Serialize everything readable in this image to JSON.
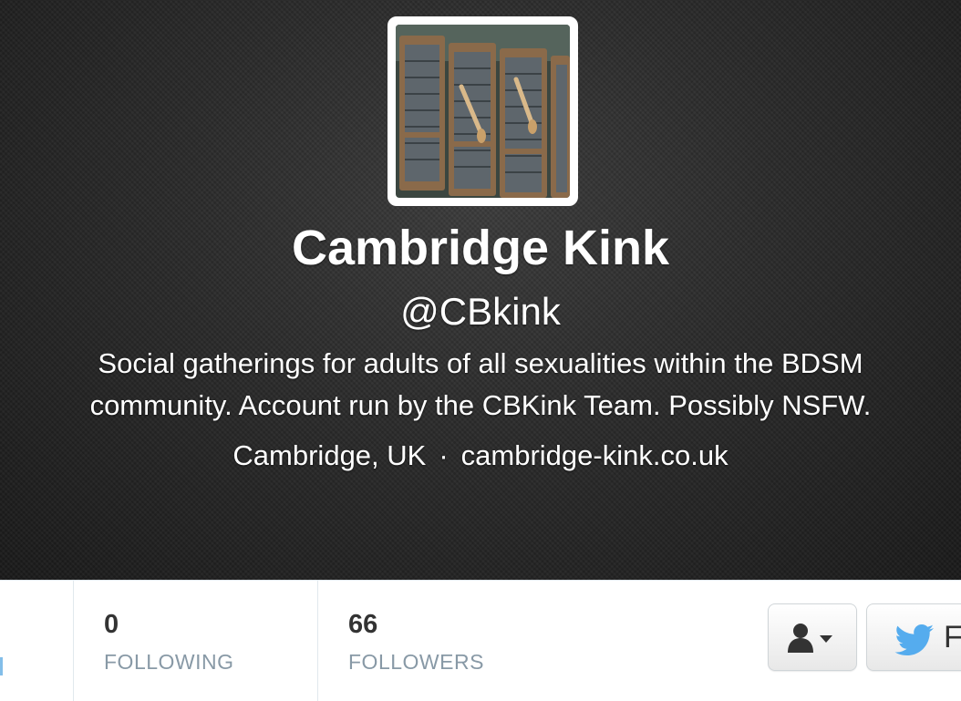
{
  "profile": {
    "name": "Cambridge Kink",
    "handle": "@CBkink",
    "bio_line1": "Social gatherings for adults of all sexualities within the BDSM",
    "bio_line2": "community. Account run by the CBKink Team. Possibly NSFW.",
    "location": "Cambridge, UK",
    "separator": "·",
    "website": "cambridge-kink.co.uk"
  },
  "stats": {
    "following": {
      "count": "0",
      "label": "FOLLOWING"
    },
    "followers": {
      "count": "66",
      "label": "FOLLOWERS"
    }
  },
  "actions": {
    "user_menu_icon": "user-dropdown-icon",
    "follow_icon": "twitter-bird-icon",
    "follow_label_visible": "F"
  },
  "colors": {
    "header_bg": "#262626",
    "text_on_header": "#ffffff",
    "stat_label": "#8899a6",
    "twitter_blue": "#55acee"
  }
}
